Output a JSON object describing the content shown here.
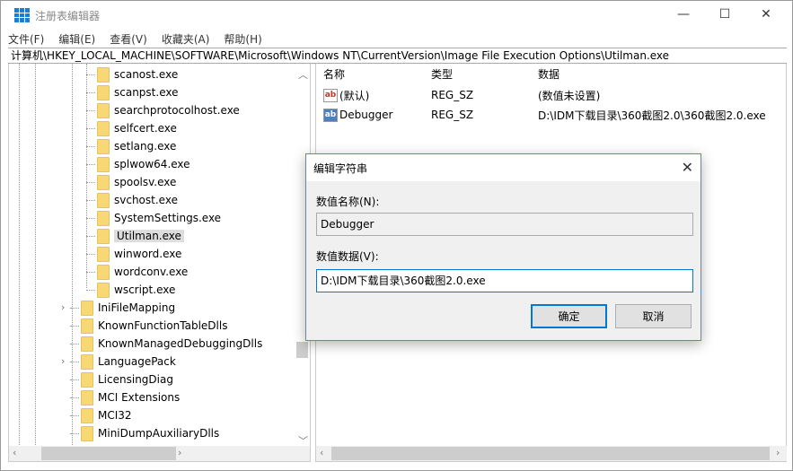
{
  "window": {
    "title": "注册表编辑器",
    "minimize": "—",
    "maximize": "☐",
    "close": "✕"
  },
  "menu": [
    "文件(F)",
    "编辑(E)",
    "查看(V)",
    "收藏夹(A)",
    "帮助(H)"
  ],
  "address": "计算机\\HKEY_LOCAL_MACHINE\\SOFTWARE\\Microsoft\\Windows NT\\CurrentVersion\\Image File Execution Options\\Utilman.exe",
  "tree": {
    "children": [
      "scanost.exe",
      "scanpst.exe",
      "searchprotocolhost.exe",
      "selfcert.exe",
      "setlang.exe",
      "splwow64.exe",
      "spoolsv.exe",
      "svchost.exe",
      "SystemSettings.exe",
      "Utilman.exe",
      "winword.exe",
      "wordconv.exe",
      "wscript.exe"
    ],
    "selected": "Utilman.exe",
    "siblings": [
      {
        "label": "IniFileMapping",
        "expandable": true
      },
      {
        "label": "KnownFunctionTableDlls",
        "expandable": false
      },
      {
        "label": "KnownManagedDebuggingDlls",
        "expandable": false
      },
      {
        "label": "LanguagePack",
        "expandable": true
      },
      {
        "label": "LicensingDiag",
        "expandable": false
      },
      {
        "label": "MCI Extensions",
        "expandable": false
      },
      {
        "label": "MCI32",
        "expandable": false
      },
      {
        "label": "MiniDumpAuxiliaryDlls",
        "expandable": false
      }
    ]
  },
  "list": {
    "headers": [
      "名称",
      "类型",
      "数据"
    ],
    "rows": [
      {
        "icon": "ab",
        "name": "(默认)",
        "type": "REG_SZ",
        "data": "(数值未设置)"
      },
      {
        "icon": "ab",
        "name": "Debugger",
        "type": "REG_SZ",
        "data": "D:\\IDM下载目录\\360截图2.0\\360截图2.0.exe"
      }
    ]
  },
  "dialog": {
    "title": "编辑字符串",
    "name_label": "数值名称(N):",
    "name_value": "Debugger",
    "data_label": "数值数据(V):",
    "data_value": "D:\\IDM下载目录\\360截图2.0.exe",
    "ok": "确定",
    "cancel": "取消"
  },
  "colors": {
    "accent": "#0078d7",
    "folder": "#f8d775"
  }
}
